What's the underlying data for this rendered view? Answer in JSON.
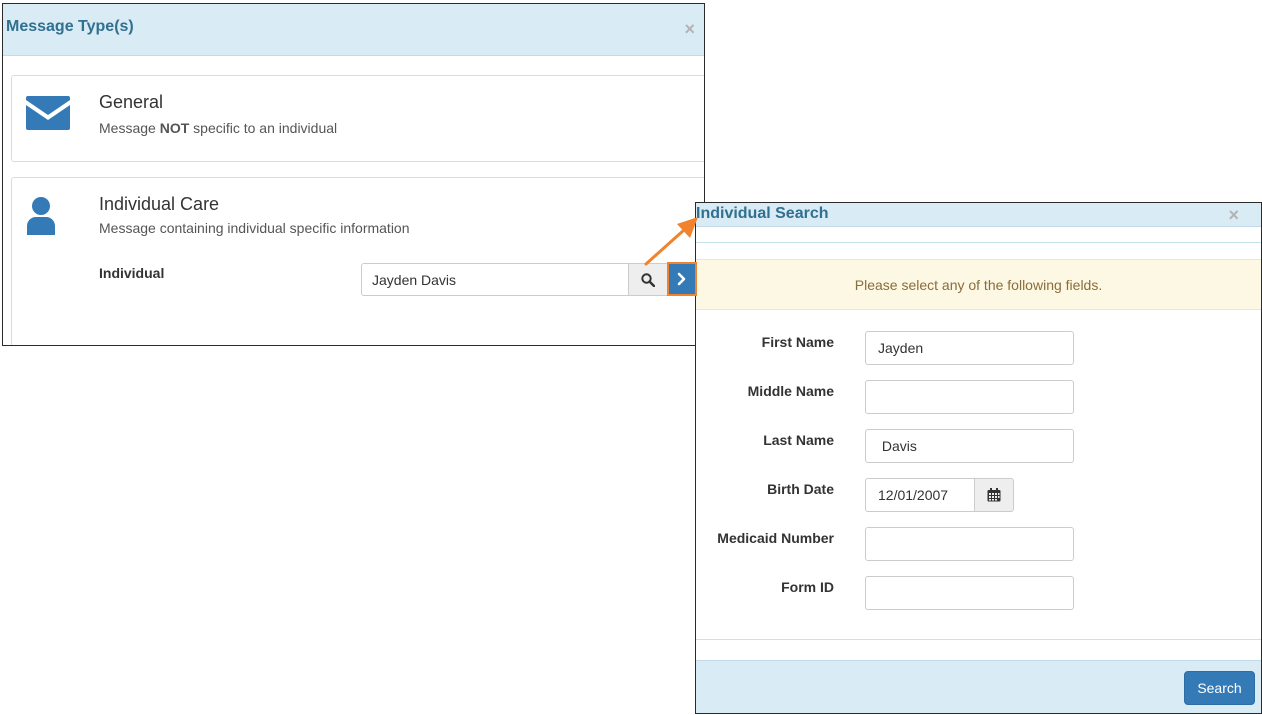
{
  "message_types_modal": {
    "title": "Message Type(s)",
    "close_glyph": "×",
    "general": {
      "icon": "envelope-icon",
      "title": "General",
      "desc_prefix": "Message ",
      "desc_bold": "NOT",
      "desc_suffix": " specific to an individual"
    },
    "individual_care": {
      "icon": "user-icon",
      "title": "Individual Care",
      "desc": "Message containing individual specific information",
      "field_label": "Individual",
      "field_value": "Jayden Davis",
      "search_icon": "search-icon",
      "go_icon": "chevron-right-icon"
    }
  },
  "individual_search_modal": {
    "title": "Individual Search",
    "close_glyph": "×",
    "alert": "Please select any of the following fields.",
    "fields": {
      "first_name": {
        "label": "First Name",
        "value": "Jayden"
      },
      "middle_name": {
        "label": "Middle Name",
        "value": ""
      },
      "last_name": {
        "label": "Last Name",
        "value": " Davis"
      },
      "birth_date": {
        "label": "Birth Date",
        "value": "12/01/2007",
        "icon": "calendar-icon"
      },
      "medicaid_number": {
        "label": "Medicaid Number",
        "value": ""
      },
      "form_id": {
        "label": "Form ID",
        "value": ""
      }
    },
    "search_button": "Search"
  },
  "colors": {
    "header_bg": "#d9ebf5",
    "title_text": "#31708f",
    "primary": "#337ab7",
    "highlight": "#f0832b",
    "alert_bg": "#fcf8e3",
    "alert_text": "#8a6d3b"
  }
}
